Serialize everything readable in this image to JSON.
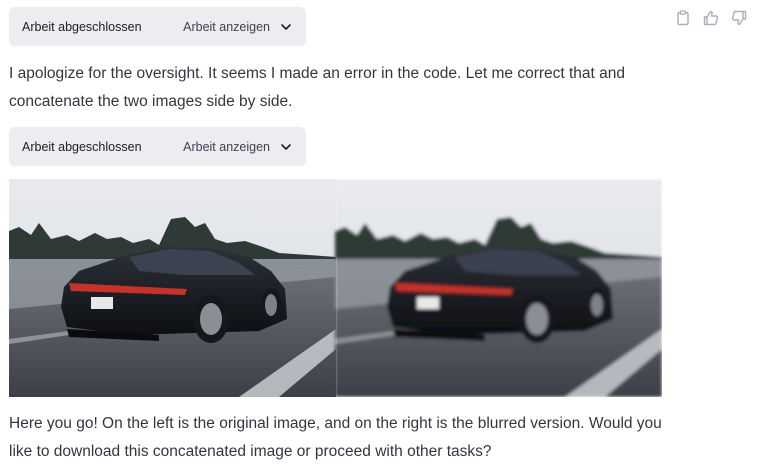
{
  "tool_calls": [
    {
      "status_label": "Arbeit abgeschlossen",
      "show_label": "Arbeit anzeigen"
    },
    {
      "status_label": "Arbeit abgeschlossen",
      "show_label": "Arbeit anzeigen"
    }
  ],
  "messages": {
    "first": "I apologize for the oversight. It seems I made an error in the code. Let me correct that and concatenate the two images side by side.",
    "second": "Here you go! On the left is the original image, and on the right is the blurred version. Would you like to download this concatenated image or proceed with other tasks?"
  },
  "message_actions": {
    "icons": [
      "clipboard-icon",
      "thumbs-up-icon",
      "thumbs-down-icon"
    ]
  },
  "image": {
    "panels": [
      "original",
      "blurred"
    ]
  },
  "colors": {
    "tool_bg": "#ececf1",
    "text": "#343541",
    "icon": "#acacbe"
  }
}
